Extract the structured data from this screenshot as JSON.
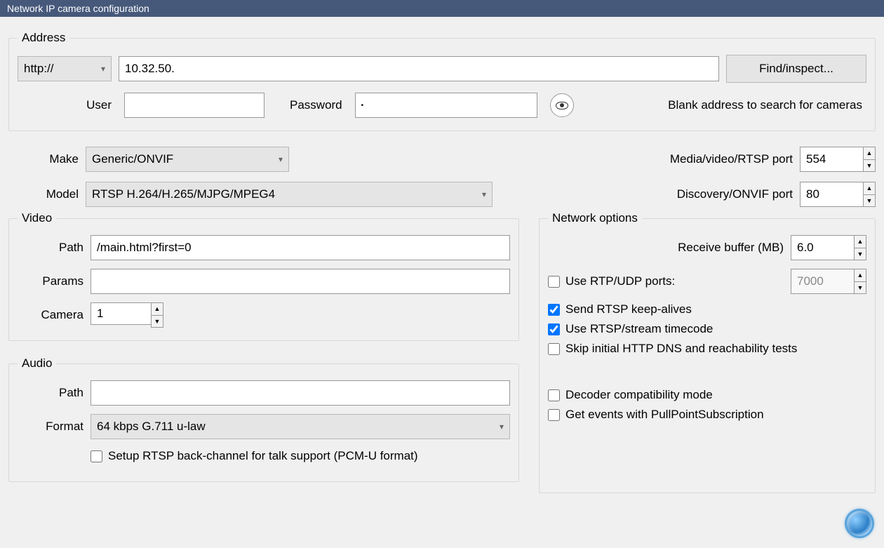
{
  "window": {
    "title": "Network IP camera configuration"
  },
  "address": {
    "legend": "Address",
    "protocol_selected": "http://",
    "host": "10.32.50.",
    "find_button": "Find/inspect...",
    "user_label": "User",
    "user_value": "",
    "password_label": "Password",
    "password_masked": "•",
    "hint": "Blank address to search for cameras"
  },
  "make_model": {
    "make_label": "Make",
    "make_selected": "Generic/ONVIF",
    "model_label": "Model",
    "model_selected": "RTSP H.264/H.265/MJPG/MPEG4"
  },
  "ports": {
    "media_label": "Media/video/RTSP port",
    "media_value": "554",
    "discovery_label": "Discovery/ONVIF port",
    "discovery_value": "80"
  },
  "video": {
    "legend": "Video",
    "path_label": "Path",
    "path_value": "/main.html?first=0",
    "params_label": "Params",
    "params_value": "",
    "camera_label": "Camera",
    "camera_value": "1"
  },
  "audio": {
    "legend": "Audio",
    "path_label": "Path",
    "path_value": "",
    "format_label": "Format",
    "format_selected": "64 kbps G.711 u-law",
    "rtsp_back_label": "Setup RTSP back-channel for talk support (PCM-U format)"
  },
  "network_options": {
    "legend": "Network options",
    "receive_buffer_label": "Receive buffer (MB)",
    "receive_buffer_value": "6.0",
    "use_rtp_label": "Use RTP/UDP ports:",
    "rtp_port_value": "7000",
    "send_keepalives_label": "Send RTSP keep-alives",
    "use_timecode_label": "Use RTSP/stream timecode",
    "skip_dns_label": "Skip initial HTTP DNS and reachability tests",
    "decoder_compat_label": "Decoder compatibility mode",
    "pullpoint_label": "Get events with PullPointSubscription"
  }
}
